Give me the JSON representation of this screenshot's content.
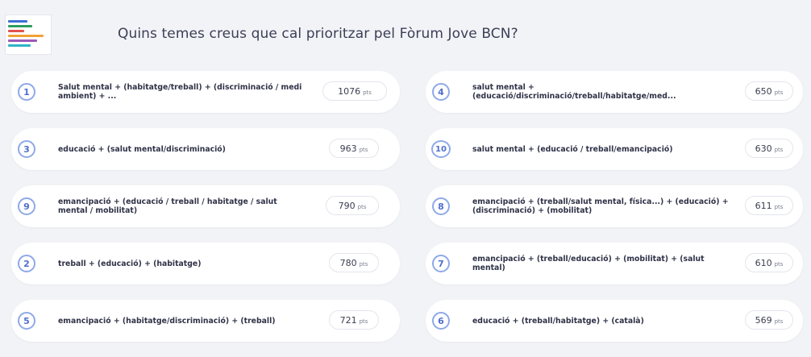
{
  "header": {
    "title": "Quins temes creus que cal prioritzar pel Fòrum Jove BCN?",
    "logo_colors": [
      "#3d6fd6",
      "#2b9e5f",
      "#e0534b",
      "#f0a236",
      "#9b59b6",
      "#2fb3c7"
    ]
  },
  "colors": {
    "page_bg": "#f2f3f7",
    "card_bg": "#ffffff",
    "rank_circle": "#8ea9e8",
    "rank_text": "#4f6fd0"
  },
  "items": [
    {
      "rank": "1",
      "label": "Salut mental + (habitatge/treball) + (discriminació / medi ambient) + ...",
      "points": "1076",
      "unit": "pts"
    },
    {
      "rank": "4",
      "label": "salut mental + (educació/discriminació/treball/habitatge/med...",
      "points": "650",
      "unit": "pts"
    },
    {
      "rank": "3",
      "label": "educació + (salut mental/discriminació)",
      "points": "963",
      "unit": "pts"
    },
    {
      "rank": "10",
      "label": "salut mental + (educació / treball/emancipació)",
      "points": "630",
      "unit": "pts"
    },
    {
      "rank": "9",
      "label": "emancipació + (educació / treball / habitatge / salut mental / mobilitat)",
      "points": "790",
      "unit": "pts"
    },
    {
      "rank": "8",
      "label": "emancipació + (treball/salut mental, física...) + (educació) + (discriminació) + (mobilitat)",
      "points": "611",
      "unit": "pts"
    },
    {
      "rank": "2",
      "label": "treball + (educació) + (habitatge)",
      "points": "780",
      "unit": "pts"
    },
    {
      "rank": "7",
      "label": "emancipació + (treball/educació) + (mobilitat) + (salut mental)",
      "points": "610",
      "unit": "pts"
    },
    {
      "rank": "5",
      "label": "emancipació + (habitatge/discriminació) + (treball)",
      "points": "721",
      "unit": "pts"
    },
    {
      "rank": "6",
      "label": "educació + (treball/habitatge) + (català)",
      "points": "569",
      "unit": "pts"
    }
  ]
}
